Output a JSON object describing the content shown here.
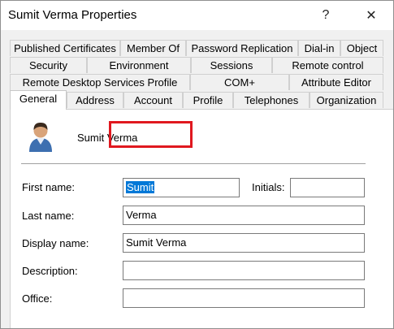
{
  "window": {
    "title": "Sumit Verma Properties",
    "help_glyph": "?",
    "close_glyph": "✕"
  },
  "tabs": {
    "row1": [
      "Published Certificates",
      "Member Of",
      "Password Replication",
      "Dial-in",
      "Object"
    ],
    "row2": [
      "Security",
      "Environment",
      "Sessions",
      "Remote control"
    ],
    "row3": [
      "Remote Desktop Services Profile",
      "COM+",
      "Attribute Editor"
    ],
    "row4": [
      "General",
      "Address",
      "Account",
      "Profile",
      "Telephones",
      "Organization"
    ],
    "active": "General"
  },
  "general": {
    "user_name": "Sumit Verma",
    "first_name_label": "First name:",
    "first_name_value": "Sumit",
    "initials_label": "Initials:",
    "initials_value": "",
    "last_name_label": "Last name:",
    "last_name_value": "Verma",
    "display_name_label": "Display name:",
    "display_name_value": "Sumit Verma",
    "description_label": "Description:",
    "description_value": "",
    "office_label": "Office:",
    "office_value": ""
  },
  "colors": {
    "selection": "#0078d7",
    "highlight_box": "#e0181f"
  }
}
